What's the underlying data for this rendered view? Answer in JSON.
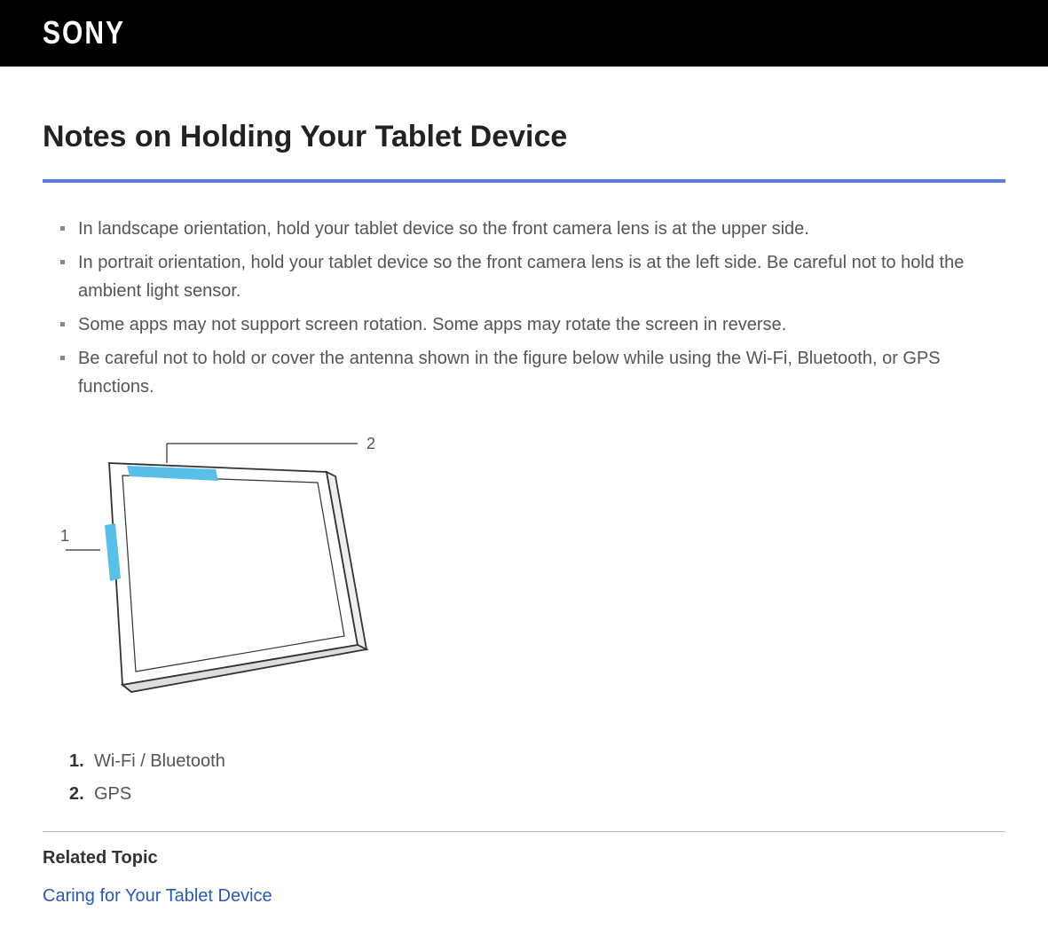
{
  "header": {
    "brand": "SONY"
  },
  "page": {
    "title": "Notes on Holding Your Tablet Device",
    "notes": [
      "In landscape orientation, hold your tablet device so the front camera lens is at the upper side.",
      "In portrait orientation, hold your tablet device so the front camera lens is at the left side. Be careful not to hold the ambient light sensor.",
      "Some apps may not support screen rotation. Some apps may rotate the screen in reverse.",
      "Be careful not to hold or cover the antenna shown in the figure below while using the Wi-Fi, Bluetooth, or GPS functions."
    ],
    "figure": {
      "callouts": {
        "label1": "1",
        "label2": "2"
      }
    },
    "legend": [
      "Wi-Fi / Bluetooth",
      "GPS"
    ],
    "related": {
      "heading": "Related Topic",
      "links": [
        "Caring for Your Tablet Device"
      ]
    }
  }
}
